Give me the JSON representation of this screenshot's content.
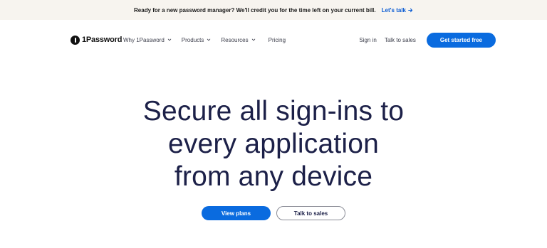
{
  "banner": {
    "message": "Ready for a new password manager? We'll credit you for the time left on your current bill.",
    "link_label": "Let's talk",
    "arrow_icon": "arrow-right-icon"
  },
  "nav": {
    "logo_text": "1Password",
    "items": [
      {
        "label": "Why 1Password",
        "has_dropdown": true
      },
      {
        "label": "Products",
        "has_dropdown": true
      },
      {
        "label": "Resources",
        "has_dropdown": true
      },
      {
        "label": "Pricing",
        "has_dropdown": false
      }
    ],
    "sign_in": "Sign in",
    "talk_to_sales": "Talk to sales",
    "get_started": "Get started free"
  },
  "hero": {
    "headline_lines": [
      "Secure all sign-ins to",
      "every application",
      "from any device"
    ],
    "primary_button": "View plans",
    "secondary_button": "Talk to sales"
  },
  "colors": {
    "accent": "#0a6bdf",
    "banner_bg": "#f7f4ef",
    "headline": "#1c2048",
    "link": "#0a5bd3"
  }
}
